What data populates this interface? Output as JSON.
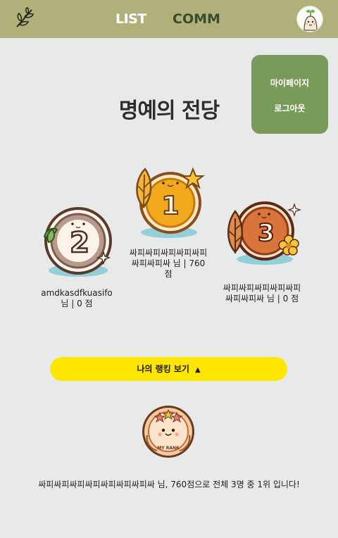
{
  "nav": {
    "logo_icon": "leaf-branch-icon",
    "list_label": "LIST",
    "comm_label": "COMM",
    "avatar_icon": "sprout-avatar-icon"
  },
  "user_menu": {
    "mypage_label": "마이페이지",
    "logout_label": "로그아웃"
  },
  "page": {
    "title": "명예의 전당"
  },
  "ranking": [
    {
      "rank": "1",
      "medal": "gold",
      "text": "싸피싸피싸피싸피싸피싸피싸피싸 님 | 760 점"
    },
    {
      "rank": "2",
      "medal": "silver",
      "text": "amdkasdfkuasifo 님 | 0 점"
    },
    {
      "rank": "3",
      "medal": "bronze",
      "text": "싸피싸피싸피싸피싸피싸피싸피싸 님 | 0 점"
    }
  ],
  "my_rank": {
    "button_label": "나의 랭킹 보기",
    "button_arrow": "▲",
    "badge_label": "MY RANK",
    "summary": "싸피싸피싸피싸피싸피싸피싸피싸 님, 760점으로 전체 3명 중 1위 입니다!"
  },
  "colors": {
    "topbar": "#b0b07a",
    "menu": "#7a9a59",
    "background": "#e8eaea",
    "button": "#ffe600",
    "gold": "#f2a91d",
    "silver": "#b89a8a",
    "bronze": "#d9743a"
  }
}
